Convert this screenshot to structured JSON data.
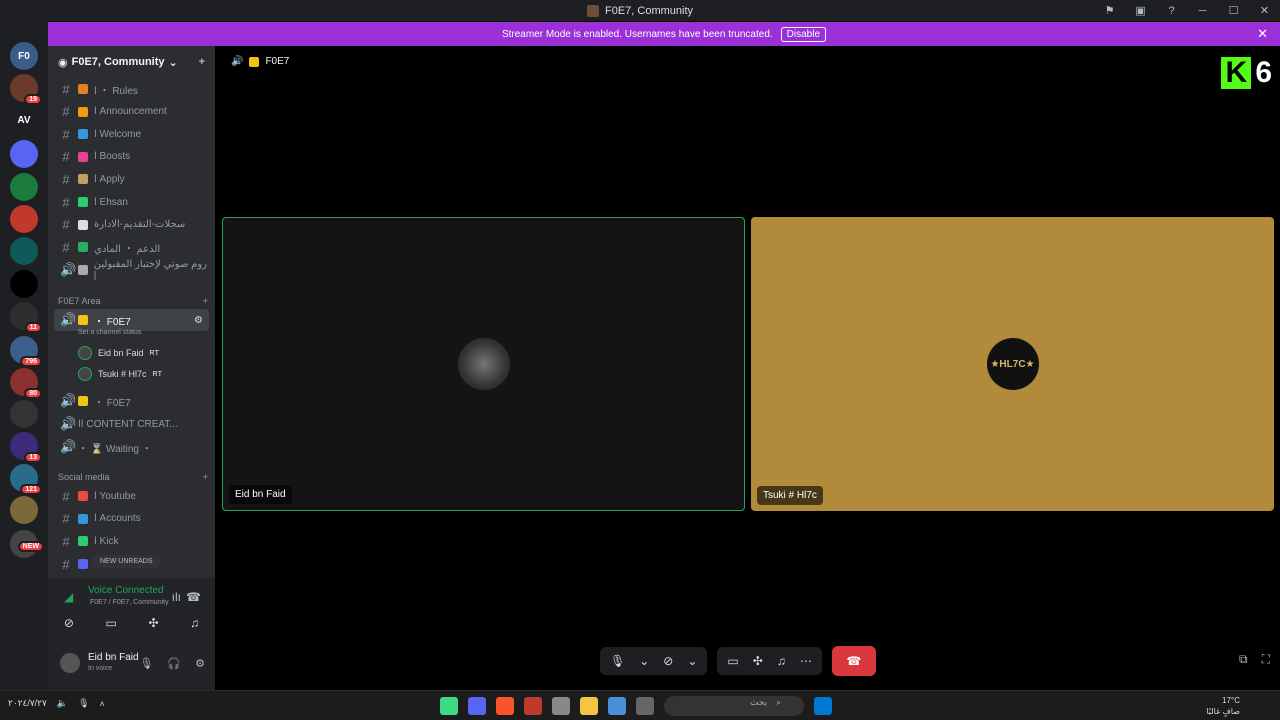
{
  "titlebar": {
    "title": "F0E7, Community"
  },
  "banner": {
    "text": "Streamer Mode is enabled. Usernames have been truncated.",
    "button": "Disable"
  },
  "guilds": [
    {
      "label": "F0",
      "badge": "",
      "color": "#3b5c8a"
    },
    {
      "label": "",
      "badge": "19",
      "color": "#6a3b2b"
    },
    {
      "label": "AV",
      "badge": "",
      "color": "#1e1f22"
    },
    {
      "label": "",
      "badge": "",
      "color": "#5865f2"
    },
    {
      "label": "",
      "badge": "",
      "color": "#1b7a3e"
    },
    {
      "label": "",
      "badge": "",
      "color": "#c0392b"
    },
    {
      "label": "",
      "badge": "",
      "color": "#0e5a5a"
    },
    {
      "label": "",
      "badge": "",
      "color": "#000000"
    },
    {
      "label": "",
      "badge": "11",
      "color": "#2e2e2e"
    },
    {
      "label": "",
      "badge": "796",
      "color": "#3a5f8a"
    },
    {
      "label": "",
      "badge": "80",
      "color": "#8a3030"
    },
    {
      "label": "",
      "badge": "",
      "color": "#333333"
    },
    {
      "label": "",
      "badge": "13",
      "color": "#3c2a7a"
    },
    {
      "label": "",
      "badge": "121",
      "color": "#2a6a8a"
    },
    {
      "label": "",
      "badge": "",
      "color": "#7a6a3a"
    },
    {
      "label": "",
      "badge": "NEW",
      "color": "#444444"
    }
  ],
  "server": {
    "name": "F0E7, Community"
  },
  "channels": [
    {
      "type": "text",
      "label": "ا ・ Rules",
      "color": "#e67e22"
    },
    {
      "type": "text",
      "label": "ا Announcement",
      "color": "#f39c12"
    },
    {
      "type": "text",
      "label": "ا Welcome",
      "color": "#3498db"
    },
    {
      "type": "text",
      "label": "ا Boosts",
      "color": "#e84393"
    },
    {
      "type": "text",
      "label": "ا Apply",
      "color": "#c0a060"
    },
    {
      "type": "text",
      "label": "ا Ehsan",
      "color": "#2ecc71"
    },
    {
      "type": "text",
      "label": "سجلات-التقديم-الادارة",
      "color": "#ddd"
    },
    {
      "type": "text",
      "label": "الدعم ・ المادي",
      "color": "#27ae60"
    },
    {
      "type": "voice",
      "label": "روم صوتي لإختبار المقبولين |",
      "color": "#aaa"
    }
  ],
  "categories": {
    "area": "F0E7 Area",
    "social": "Social media"
  },
  "voice_channel": {
    "label": "・ F0E7",
    "status": "Set a channel status"
  },
  "voice_users": [
    {
      "name": "Eid bn Faid",
      "tag": "RT"
    },
    {
      "name": "Tsuki # Hl7c",
      "tag": "RT"
    }
  ],
  "more_voice": [
    {
      "label": "・ F0E7"
    },
    {
      "label": "اا CONTENT CREAT..."
    },
    {
      "label": "・ ⌛ Waiting ・"
    }
  ],
  "social_channels": [
    {
      "label": "ا Youtube",
      "color": "#e74c3c"
    },
    {
      "label": "ا Accounts",
      "color": "#3498db"
    },
    {
      "label": "ا Kick",
      "color": "#2ecc71"
    }
  ],
  "new_unreads": "NEW UNREADS",
  "voice_panel": {
    "title": "Voice Connected",
    "sub": "F0E7 / F0E7, Community"
  },
  "user": {
    "name": "Eid bn Faid",
    "status": "In voice"
  },
  "call": {
    "channel": "F0E7",
    "participants": [
      {
        "name": "Eid bn Faid"
      },
      {
        "name": "Tsuki # Hl7c",
        "avatar_text": "★HL7C★"
      }
    ]
  },
  "kick_logo": {
    "k": "K",
    "n": "6"
  },
  "taskbar": {
    "date": "٢٠٢٤/٧/٢٧",
    "search": "بحث",
    "temp": "17°C",
    "weather": "صافٍ غالبًا"
  }
}
